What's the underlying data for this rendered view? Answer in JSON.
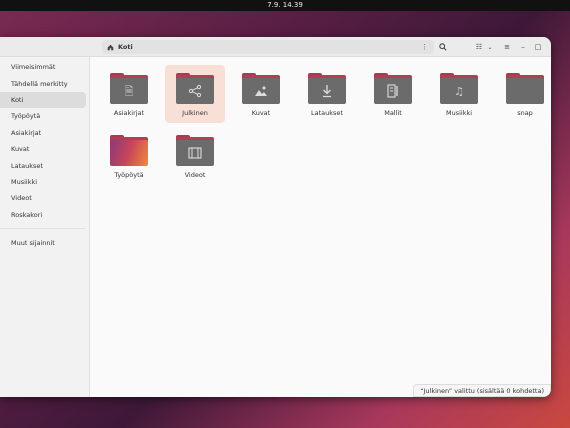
{
  "topbar": {
    "clock": "7.9.  14.39"
  },
  "headerbar": {
    "path_label": "Koti",
    "search_icon": "search-icon",
    "view_toggle_icon": "list-view-icon",
    "menu_icon": "hamburger-menu-icon"
  },
  "sidebar": {
    "items": [
      {
        "label": "Viimeisimmät",
        "icon": "clock-icon"
      },
      {
        "label": "Tähdellä merkitty",
        "icon": "star-icon"
      },
      {
        "label": "Koti",
        "icon": "home-icon"
      },
      {
        "label": "Työpöytä",
        "icon": "desktop-icon"
      },
      {
        "label": "Asiakirjat",
        "icon": "document-icon"
      },
      {
        "label": "Kuvat",
        "icon": "image-icon"
      },
      {
        "label": "Lataukset",
        "icon": "download-icon"
      },
      {
        "label": "Musiikki",
        "icon": "music-icon"
      },
      {
        "label": "Videot",
        "icon": "video-icon"
      },
      {
        "label": "Roskakori",
        "icon": "trash-icon"
      }
    ],
    "other_locations": "Muut sijainnit"
  },
  "folders": [
    {
      "label": "Asiakirjat",
      "emblem": "document-icon"
    },
    {
      "label": "Julkinen",
      "emblem": "share-icon"
    },
    {
      "label": "Kuvat",
      "emblem": "image-icon"
    },
    {
      "label": "Lataukset",
      "emblem": "download-icon"
    },
    {
      "label": "Mallit",
      "emblem": "template-icon"
    },
    {
      "label": "Musiikki",
      "emblem": "music-icon"
    },
    {
      "label": "snap",
      "emblem": ""
    },
    {
      "label": "Työpöytä",
      "emblem": "desktop-icon"
    },
    {
      "label": "Videot",
      "emblem": "video-icon"
    }
  ],
  "status": "“Julkinen” valittu  (sisältää 0 kohdetta)",
  "colors": {
    "accent": "#e95420",
    "folder_tab": "#b13d57",
    "folder_body": "#6b6b6b"
  }
}
